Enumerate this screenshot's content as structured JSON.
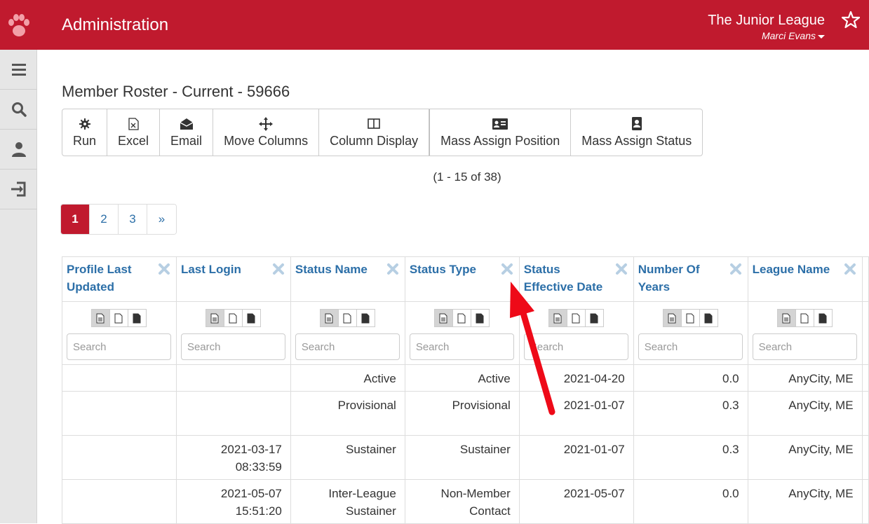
{
  "header": {
    "title": "Administration",
    "org_name": "The Junior League",
    "user_name": "Marci Evans",
    "brand_color": "#c01a2e"
  },
  "sidebar": {
    "items": [
      {
        "icon": "menu-icon"
      },
      {
        "icon": "search-icon"
      },
      {
        "icon": "user-icon"
      },
      {
        "icon": "sign-out-icon"
      }
    ]
  },
  "page": {
    "title": "Member Roster - Current - 59666",
    "record_count": "(1 - 15 of 38)"
  },
  "toolbar": {
    "run": "Run",
    "excel": "Excel",
    "email": "Email",
    "move_columns": "Move Columns",
    "column_display": "Column Display",
    "mass_assign_position": "Mass Assign Position",
    "mass_assign_status": "Mass Assign Status"
  },
  "pagination": {
    "pages": [
      "1",
      "2",
      "3",
      "»"
    ],
    "active": "1"
  },
  "table": {
    "search_placeholder": "Search",
    "columns": [
      {
        "line1": "Profile Last",
        "line2": "Updated"
      },
      {
        "line1": "Last Login",
        "line2": ""
      },
      {
        "line1": "Status Name",
        "line2": ""
      },
      {
        "line1": "Status Type",
        "line2": ""
      },
      {
        "line1": "Status",
        "line2": "Effective Date"
      },
      {
        "line1": "Number Of",
        "line2": "Years"
      },
      {
        "line1": "League Name",
        "line2": ""
      }
    ],
    "rows": [
      [
        "",
        "",
        "Active",
        "Active",
        "2021-04-20",
        "0.0",
        "AnyCity, ME"
      ],
      [
        "",
        "",
        "Provisional",
        "Provisional",
        "2021-01-07",
        "0.3",
        "AnyCity, ME"
      ],
      [
        "",
        "2021-03-17",
        "Sustainer",
        "Sustainer",
        "2021-01-07",
        "0.3",
        "AnyCity, ME"
      ],
      [
        "",
        "2021-05-07",
        "Inter-League",
        "Non-Member",
        "2021-05-07",
        "0.0",
        "AnyCity, ME"
      ]
    ],
    "rows_line2": [
      [
        "",
        "",
        "",
        "",
        "",
        "",
        ""
      ],
      [
        "",
        "",
        "",
        "",
        "",
        "",
        ""
      ],
      [
        "",
        "08:33:59",
        "",
        "",
        "",
        "",
        ""
      ],
      [
        "",
        "15:51:20",
        "Sustainer",
        "Contact",
        "",
        "",
        ""
      ]
    ]
  }
}
